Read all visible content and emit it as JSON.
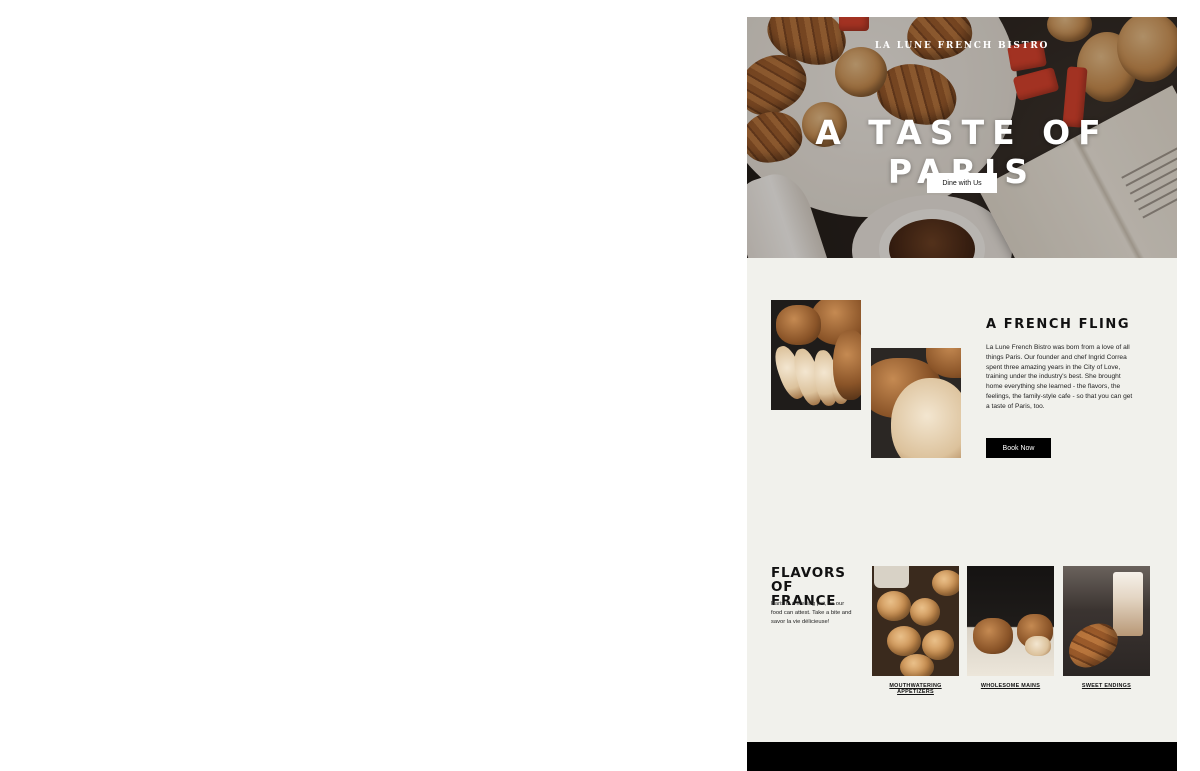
{
  "hero": {
    "eyebrow": "LA LUNE FRENCH BISTRO",
    "title": "A TASTE OF PARIS",
    "cta_label": "Dine with Us"
  },
  "about": {
    "title": "A FRENCH FLING",
    "body": "La Lune French Bistro was born from a love of all things Paris. Our founder and chef Ingrid Correa spent three amazing years in the City of Love, training under the industry's best. She brought home everything she learned - the flavors, the feelings, the family-style cafe - so that you can get a taste of Paris, too.",
    "cta_label": "Book Now"
  },
  "flavors": {
    "title_line1": "FLAVORS",
    "title_line2": "OF FRANCE",
    "body": "Paris is a melting pot, as our food can attest. Take a bite and savor la vie délicieuse!",
    "items": [
      {
        "label": "MOUTHWATERING APPETIZERS"
      },
      {
        "label": "WHOLESOME MAINS"
      },
      {
        "label": "SWEET ENDINGS"
      }
    ]
  },
  "colors": {
    "page_background": "#f1f1ec",
    "button_dark": "#000000",
    "button_light": "#ffffff",
    "footer": "#000000"
  }
}
